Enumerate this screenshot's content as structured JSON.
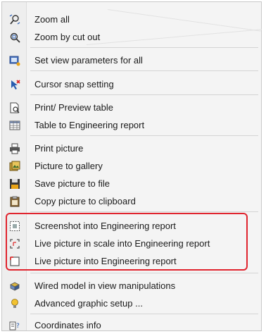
{
  "menu": {
    "items": [
      {
        "label": "Zoom all",
        "icon": "zoom-all-icon"
      },
      {
        "label": "Zoom by cut out",
        "icon": "zoom-cutout-icon"
      },
      {
        "label": "Set view parameters for all",
        "icon": "view-parameters-icon"
      },
      {
        "label": "Cursor snap setting",
        "icon": "cursor-snap-icon"
      },
      {
        "label": "Print/ Preview table",
        "icon": "print-preview-icon"
      },
      {
        "label": "Table to Engineering report",
        "icon": "table-icon"
      },
      {
        "label": "Print picture",
        "icon": "printer-icon"
      },
      {
        "label": "Picture to gallery",
        "icon": "gallery-icon"
      },
      {
        "label": "Save picture to file",
        "icon": "save-icon"
      },
      {
        "label": "Copy picture to clipboard",
        "icon": "clipboard-icon"
      },
      {
        "label": "Screenshot into Engineering report",
        "icon": "screenshot-icon"
      },
      {
        "label": "Live picture in scale into Engineering report",
        "icon": "live-picture-scale-icon"
      },
      {
        "label": "Live picture into Engineering report",
        "icon": "live-picture-icon"
      },
      {
        "label": "Wired model in view manipulations",
        "icon": "wired-model-icon"
      },
      {
        "label": "Advanced graphic setup ...",
        "icon": "lightbulb-icon"
      },
      {
        "label": "Coordinates info",
        "icon": "coordinates-icon"
      }
    ]
  },
  "colors": {
    "highlight": "#e0242e",
    "accent_blue": "#2a5db0"
  }
}
